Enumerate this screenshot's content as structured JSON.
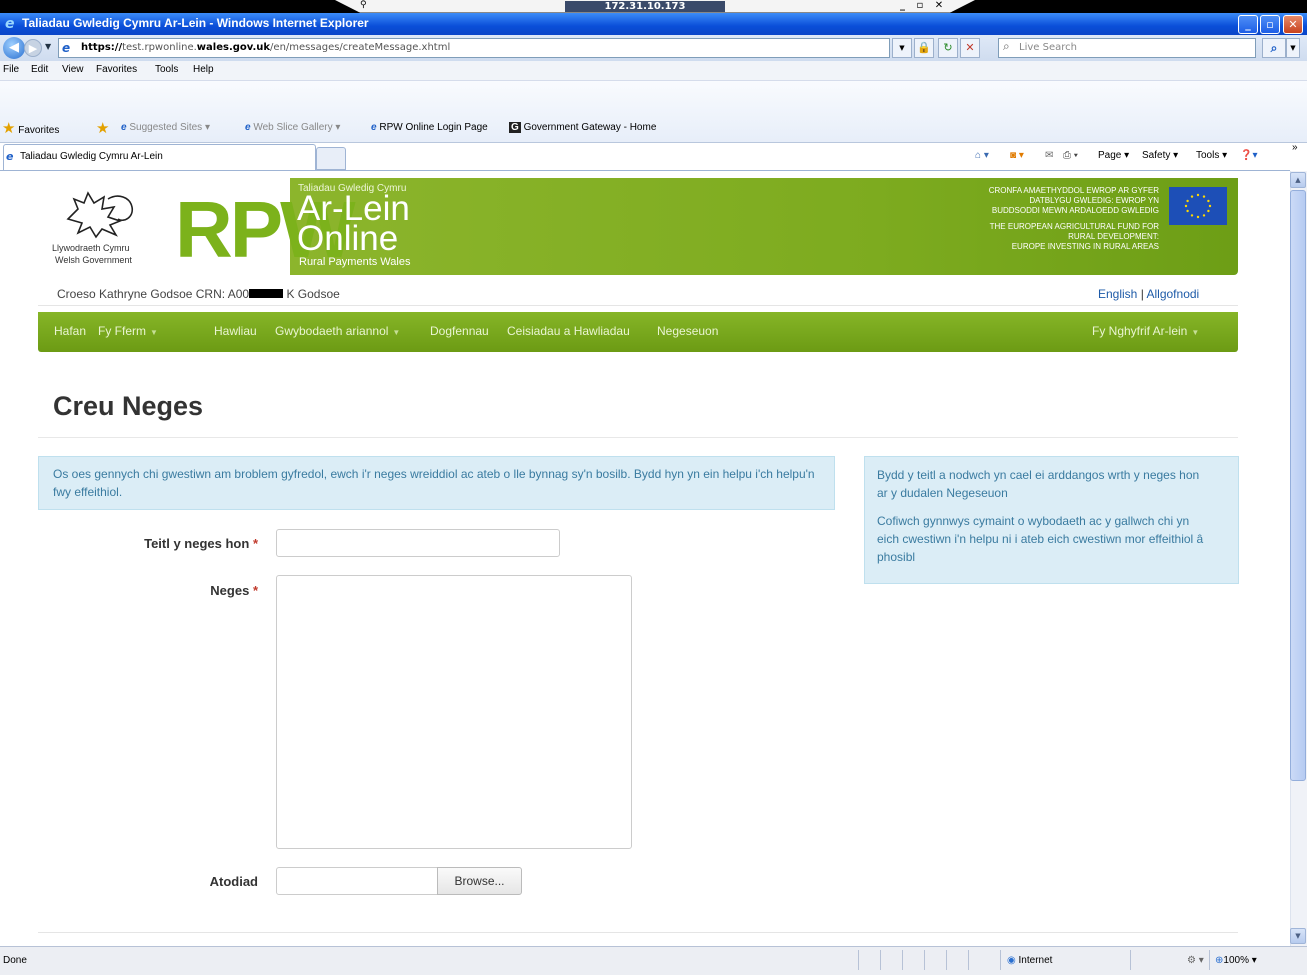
{
  "rdp": {
    "host": "172.31.10.173"
  },
  "window": {
    "title": "Taliadau Gwledig Cymru Ar-Lein - Windows Internet Explorer",
    "controls": [
      "_",
      "▫",
      "✕"
    ]
  },
  "address": {
    "url_prefix": "https://",
    "url_host_pre": "test.rpwonline.",
    "url_host_main": "wales.gov.uk",
    "url_path": "/en/messages/createMessage.xhtml",
    "search_placeholder": "Live Search"
  },
  "menu": [
    "File",
    "Edit",
    "View",
    "Favorites",
    "Tools",
    "Help"
  ],
  "favorites": {
    "label": "Favorites",
    "items": [
      "Suggested Sites ▾",
      "Web Slice Gallery ▾",
      "RPW Online Login Page",
      "Government Gateway - Home"
    ]
  },
  "tab": {
    "label": "Taliadau Gwledig Cymru Ar-Lein"
  },
  "command_bar": [
    "Page ▾",
    "Safety ▾",
    "Tools ▾"
  ],
  "site": {
    "gov_cy": "Llywodraeth Cymru",
    "gov_en": "Welsh Government",
    "logo": "RPW",
    "sub_cy": "Taliadau Gwledig Cymru",
    "ar_lein": "Ar-Lein",
    "online": "Online",
    "sub_en": "Rural Payments Wales",
    "eu_cy": [
      "CRONFA AMAETHYDDOL EWROP AR GYFER",
      "DATBLYGU GWLEDIG: EWROP YN",
      "BUDDSODDI MEWN ARDALOEDD GWLEDIG"
    ],
    "eu_en": [
      "THE EUROPEAN AGRICULTURAL FUND FOR",
      "RURAL DEVELOPMENT:",
      "EUROPE INVESTING IN RURAL AREAS"
    ]
  },
  "welcome": {
    "prefix": "Croeso Kathryne Godsoe CRN: A00",
    "suffix": "K Godsoe",
    "lang_english": "English",
    "separator": "|",
    "logout": "Allgofnodi"
  },
  "nav": {
    "items": [
      "Hafan",
      "Fy Fferm",
      "Hawliau",
      "Gwybodaeth ariannol",
      "Dogfennau",
      "Ceisiadau a Hawliadau",
      "Negeseuon"
    ],
    "account": "Fy Nghyfrif Ar-lein"
  },
  "page": {
    "title": "Creu Neges",
    "info_left": "Os oes gennych chi gwestiwn am broblem gyfredol, ewch i'r neges wreiddiol ac ateb o lle bynnag sy'n bosilb. Bydd hyn yn ein helpu i'ch helpu'n fwy effeithiol.",
    "info_right_1": "Bydd y teitl a nodwch yn cael ei arddangos wrth y neges hon ar y dudalen Negeseuon",
    "info_right_2": "Cofiwch gynnwys cymaint o wybodaeth ac y gallwch chi yn eich cwestiwn i'n helpu ni i ateb eich cwestiwn mor effeithiol â phosibl",
    "label_title": "Teitl y neges hon",
    "label_message": "Neges",
    "label_attachment": "Atodiad",
    "required_mark": "*",
    "browse": "Browse...",
    "title_value": "",
    "message_value": "",
    "file_value": ""
  },
  "status": {
    "text": "Done",
    "zone": "Internet",
    "zoom": "100%"
  }
}
